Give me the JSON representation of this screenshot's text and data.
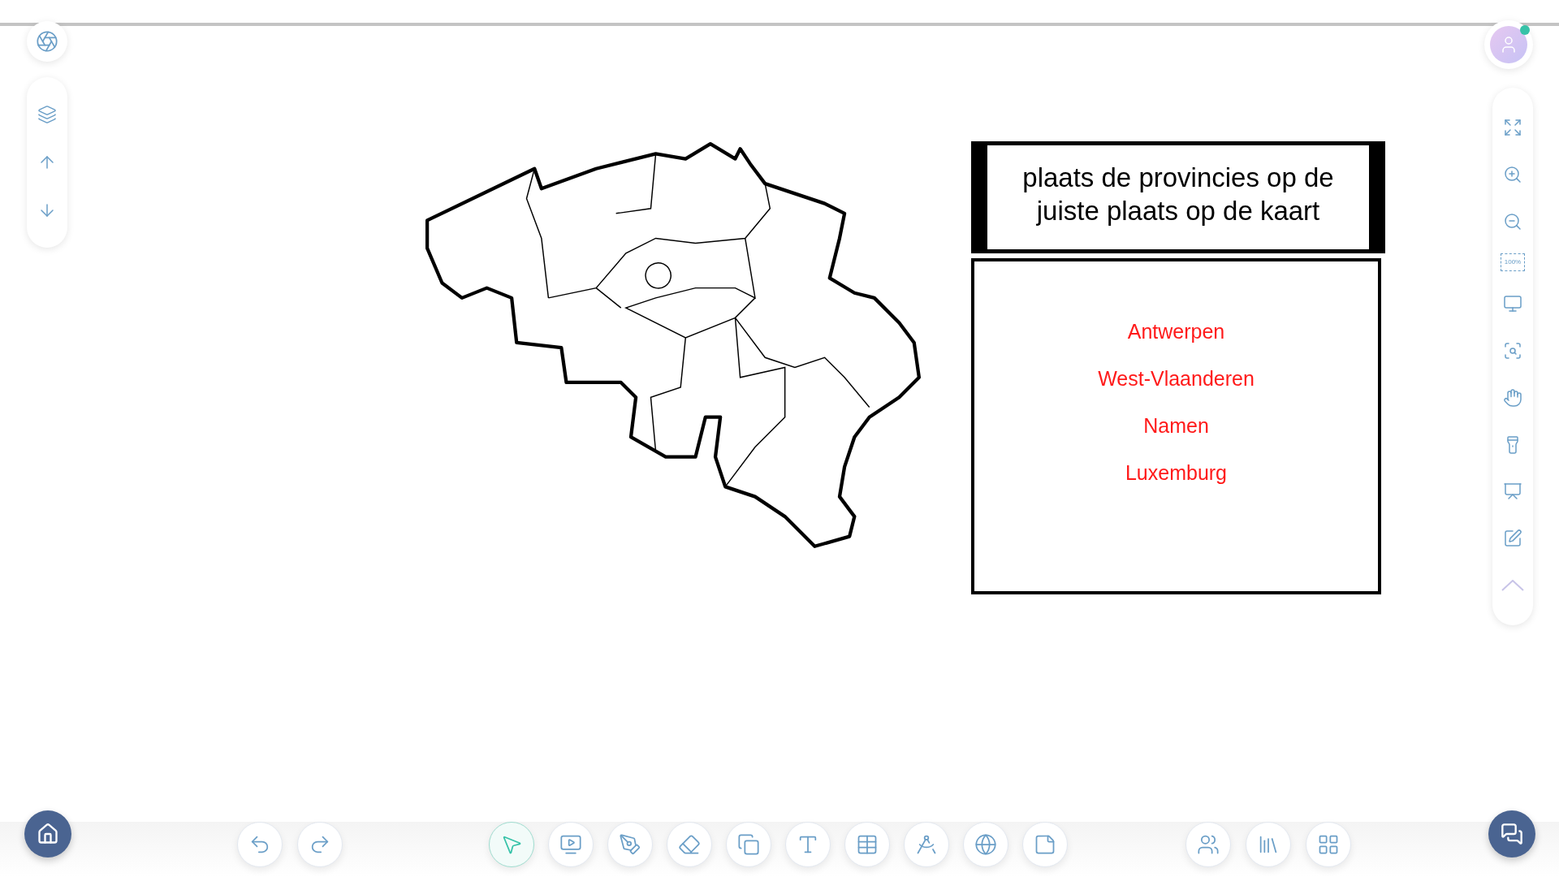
{
  "canvas": {
    "title": "plaats de provincies op de juiste plaats op de kaart",
    "words": [
      "Antwerpen",
      "West-Vlaanderen",
      "Namen",
      "Luxemburg"
    ]
  },
  "left_toolbar": [
    {
      "kind": "layers"
    },
    {
      "kind": "up"
    },
    {
      "kind": "down"
    }
  ],
  "right_toolbar": [
    {
      "kind": "fullscreen"
    },
    {
      "kind": "zoom-in"
    },
    {
      "kind": "zoom-out"
    },
    {
      "kind": "fit",
      "label": "100%"
    },
    {
      "kind": "display"
    },
    {
      "kind": "zoom-area"
    },
    {
      "kind": "pan"
    },
    {
      "kind": "spotlight"
    },
    {
      "kind": "screen"
    },
    {
      "kind": "annotate"
    },
    {
      "kind": "collapse"
    }
  ],
  "undo_tools": [
    {
      "kind": "undo"
    },
    {
      "kind": "redo"
    }
  ],
  "tools": [
    {
      "kind": "select",
      "selected": true
    },
    {
      "kind": "media",
      "selected": false
    },
    {
      "kind": "pen",
      "selected": false
    },
    {
      "kind": "eraser",
      "selected": false
    },
    {
      "kind": "shapes",
      "selected": false
    },
    {
      "kind": "text",
      "selected": false
    },
    {
      "kind": "table",
      "selected": false
    },
    {
      "kind": "geometry",
      "selected": false
    },
    {
      "kind": "browser",
      "selected": false
    },
    {
      "kind": "note",
      "selected": false
    }
  ],
  "extra_tools": [
    {
      "kind": "classroom"
    },
    {
      "kind": "library"
    },
    {
      "kind": "apps"
    }
  ],
  "user": {
    "online": true
  }
}
